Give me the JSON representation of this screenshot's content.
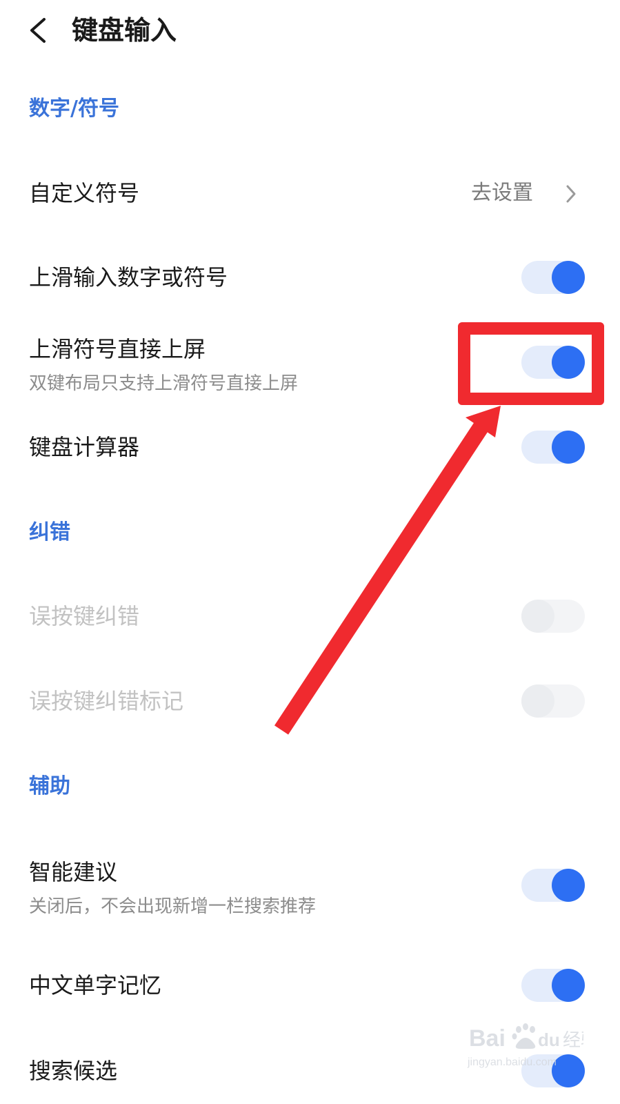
{
  "header": {
    "title": "键盘输入",
    "back_icon": "chevron-left-icon"
  },
  "sections": {
    "numbers": {
      "title": "数字/符号",
      "custom_symbol": {
        "label": "自定义符号",
        "action": "去设置"
      },
      "swipe_input": {
        "label": "上滑输入数字或符号",
        "enabled": true
      },
      "swipe_direct": {
        "label": "上滑符号直接上屏",
        "description": "双键布局只支持上滑符号直接上屏",
        "enabled": true
      },
      "calculator": {
        "label": "键盘计算器",
        "enabled": true
      }
    },
    "correction": {
      "title": "纠错",
      "mistouch": {
        "label": "误按键纠错",
        "enabled": false,
        "disabled": true
      },
      "mistouch_mark": {
        "label": "误按键纠错标记",
        "enabled": false,
        "disabled": true
      }
    },
    "assist": {
      "title": "辅助",
      "smart_suggest": {
        "label": "智能建议",
        "description": "关闭后，不会出现新增一栏搜索推荐",
        "enabled": true
      },
      "char_memory": {
        "label": "中文单字记忆",
        "enabled": true
      },
      "search_candidates": {
        "label": "搜索候选",
        "enabled": true
      }
    }
  },
  "annotation": {
    "color": "#f02a2f"
  },
  "watermark": {
    "brand": "Baidu经验",
    "url": "jingyan.baidu.com"
  },
  "colors": {
    "accent": "#2d6ff3",
    "section": "#3a73d9"
  }
}
